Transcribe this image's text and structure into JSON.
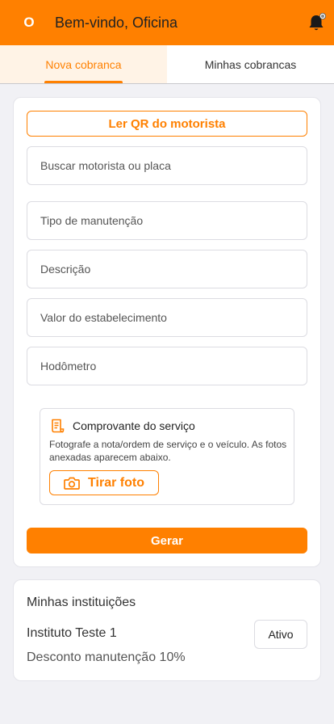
{
  "header": {
    "avatar_initial": "O",
    "title": "Bem-vindo, Oficina",
    "accent_color": "#ff8000",
    "icon": "bell-icon"
  },
  "tabs": [
    {
      "label": "Nova cobranca",
      "active": true
    },
    {
      "label": "Minhas cobrancas",
      "active": false
    }
  ],
  "form": {
    "qr_button_label": "Ler QR do motorista",
    "fields": {
      "search": {
        "placeholder": "Buscar motorista ou placa",
        "value": ""
      },
      "maintenance_type": {
        "placeholder": "Tipo de manutenção",
        "value": ""
      },
      "description": {
        "placeholder": "Descrição",
        "value": ""
      },
      "amount": {
        "placeholder": "Valor do estabelecimento",
        "value": ""
      },
      "odometer": {
        "placeholder": "Hodômetro",
        "value": ""
      }
    },
    "receipt": {
      "icon": "receipt-icon",
      "title": "Comprovante do serviço",
      "description": "Fotografe a nota/ordem de serviço e o veículo. As fotos anexadas aparecem abaixo.",
      "photo_button_label": "Tirar foto",
      "photo_icon": "camera-icon"
    },
    "generate_button_label": "Gerar"
  },
  "institutions": {
    "title": "Minhas instituições",
    "items": [
      {
        "name": "Instituto Teste 1",
        "discount": "Desconto manutenção 10%",
        "status": "Ativo"
      }
    ]
  }
}
